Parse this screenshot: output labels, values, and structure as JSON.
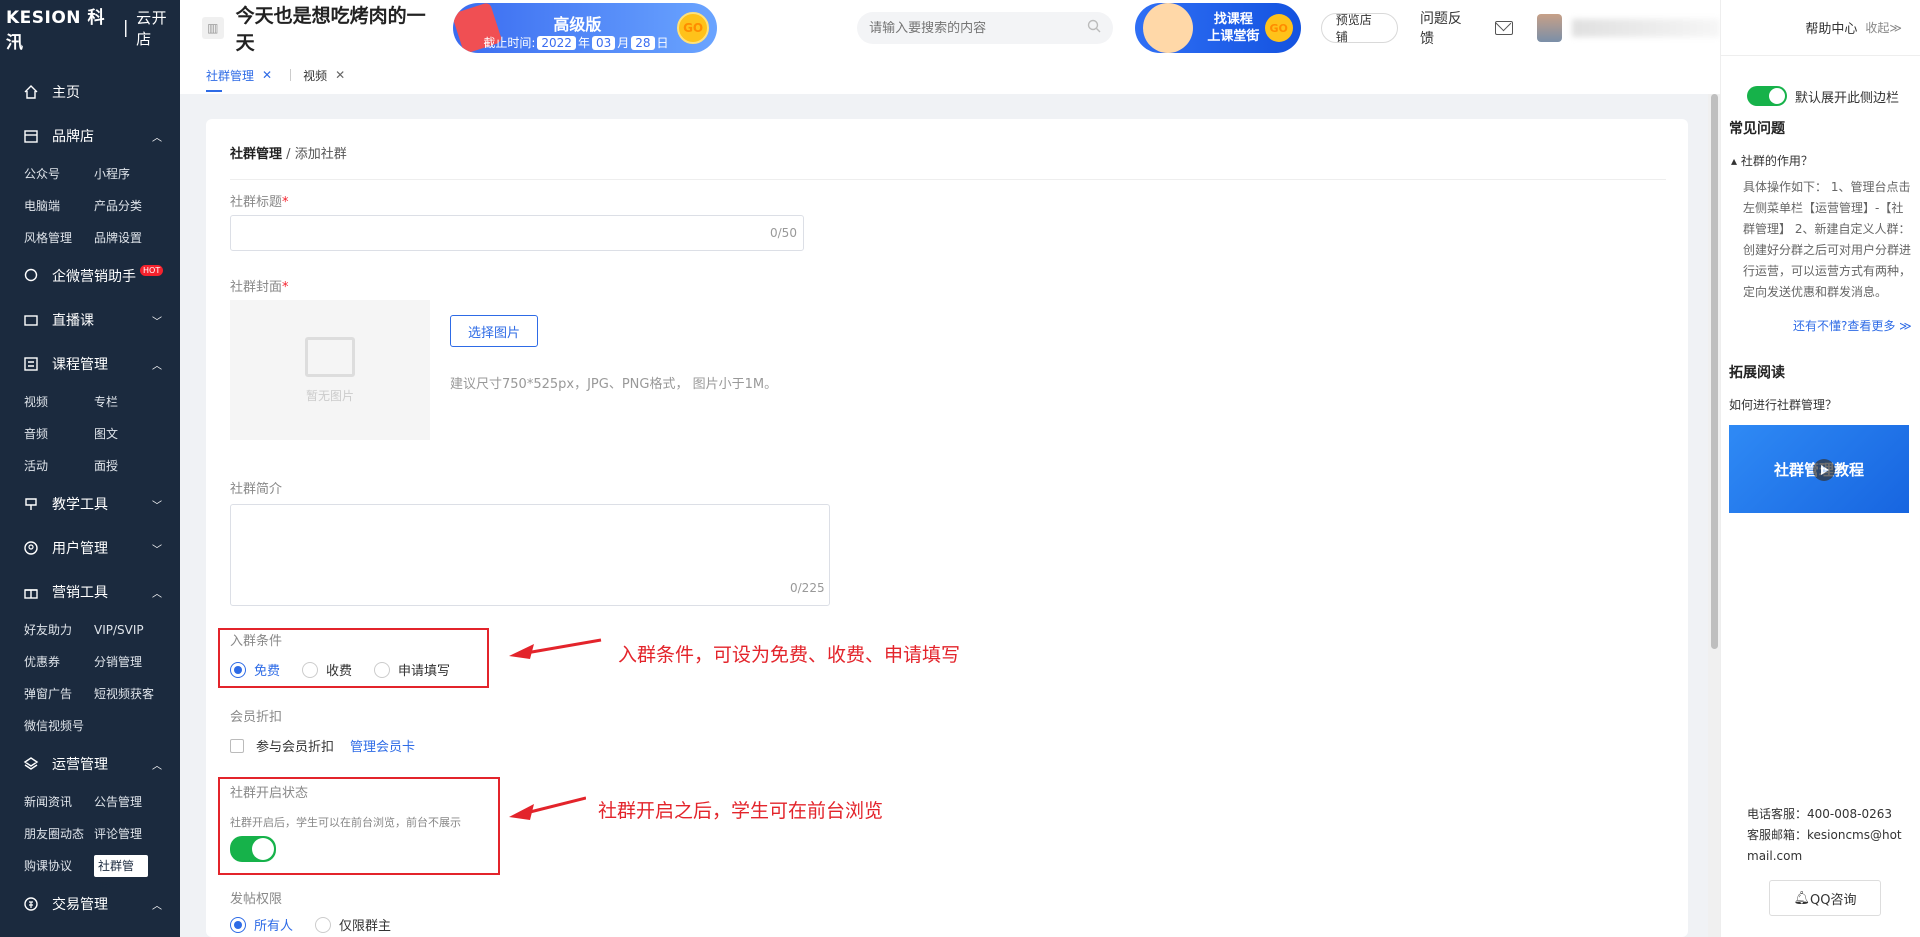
{
  "sidebar": {
    "logo_brand": "KESION 科汛",
    "logo_sub": "云开店",
    "groups": [
      {
        "label": "主页",
        "icon": "home-icon"
      },
      {
        "label": "品牌店",
        "icon": "store-icon",
        "sub": [
          "公众号",
          "小程序",
          "电脑端",
          "产品分类",
          "风格管理",
          "品牌设置"
        ]
      },
      {
        "label": "企微营销助手",
        "icon": "chat-icon",
        "badge": "HOT"
      },
      {
        "label": "直播课",
        "icon": "live-icon"
      },
      {
        "label": "课程管理",
        "icon": "course-icon",
        "sub": [
          "视频",
          "专栏",
          "音频",
          "图文",
          "活动",
          "面授"
        ]
      },
      {
        "label": "教学工具",
        "icon": "tool-icon"
      },
      {
        "label": "用户管理",
        "icon": "user-icon"
      },
      {
        "label": "营销工具",
        "icon": "gift-icon",
        "sub": [
          "好友助力",
          "VIP/SVIP",
          "优惠券",
          "分销管理",
          "弹窗广告",
          "短视频获客",
          "微信视频号"
        ]
      },
      {
        "label": "运营管理",
        "icon": "layers-icon",
        "sub": [
          "新闻资讯",
          "公告管理",
          "朋友圈动态",
          "评论管理",
          "购课协议",
          "社群管理"
        ]
      },
      {
        "label": "交易管理",
        "icon": "dollar-icon"
      }
    ]
  },
  "header": {
    "store_name": "今天也是想吃烤肉的一天",
    "version_label": "高级版",
    "expiry_prefix": "截止时间:",
    "expiry_year": "2022",
    "expiry_year_unit": "年",
    "expiry_month": "03",
    "expiry_month_unit": "月",
    "expiry_day": "28",
    "expiry_day_unit": "日",
    "go_label": "GO",
    "search_placeholder": "请输入要搜索的内容",
    "promo_line1": "找课程",
    "promo_line2": "上课堂街",
    "preview_store": "预览店铺",
    "feedback": "问题反馈"
  },
  "tabs": [
    {
      "label": "社群管理",
      "active": true
    },
    {
      "label": "视频",
      "active": false
    }
  ],
  "form": {
    "breadcrumb_root": "社群管理",
    "breadcrumb_sep": "/",
    "breadcrumb_current": "添加社群",
    "title_label": "社群标题",
    "title_counter": "0/50",
    "cover_label": "社群封面",
    "no_image": "暂无图片",
    "choose_image": "选择图片",
    "cover_hint": "建议尺寸750*525px，JPG、PNG格式， 图片小于1M。",
    "intro_label": "社群简介",
    "intro_counter": "0/225",
    "join_label": "入群条件",
    "join_options": [
      "免费",
      "收费",
      "申请填写"
    ],
    "join_selected": "免费",
    "member_label": "会员折扣",
    "member_checkbox": "参与会员折扣",
    "member_link": "管理会员卡",
    "status_label": "社群开启状态",
    "status_hint": "社群开启后，学生可以在前台浏览，前台不展示",
    "status_on": true,
    "post_label": "发帖权限",
    "post_options": [
      "所有人",
      "仅限群主"
    ],
    "post_selected": "所有人"
  },
  "annotations": {
    "join": "入群条件，可设为免费、收费、申请填写",
    "status": "社群开启之后，学生可在前台浏览"
  },
  "right_panel": {
    "help_center": "帮助中心",
    "collapse": "收起≫",
    "default_expand": "默认展开此侧边栏",
    "faq_title": "常见问题",
    "faq_q": "社群的作用？",
    "faq_a": "具体操作如下： 1、管理台点击左侧菜单栏【运营管理】-【社群管理】 2、新建自定义人群：创建好分群之后可对用户分群进行运营，可以运营方式有两种，定向发送优惠和群发消息。",
    "faq_more": "还有不懂?查看更多 ≫",
    "ext_title": "拓展阅读",
    "ext_q": "如何进行社群管理？",
    "video_text": "社群管理教程",
    "phone": "电话客服：400-008-0263",
    "email": "客服邮箱：kesioncms@hotmail.com",
    "qq": "QQ咨询"
  },
  "colors": {
    "sidebar_bg": "#1b2a3e",
    "accent": "#2e6be6",
    "switch_on": "#16b24a",
    "annotation": "#e3242b"
  }
}
